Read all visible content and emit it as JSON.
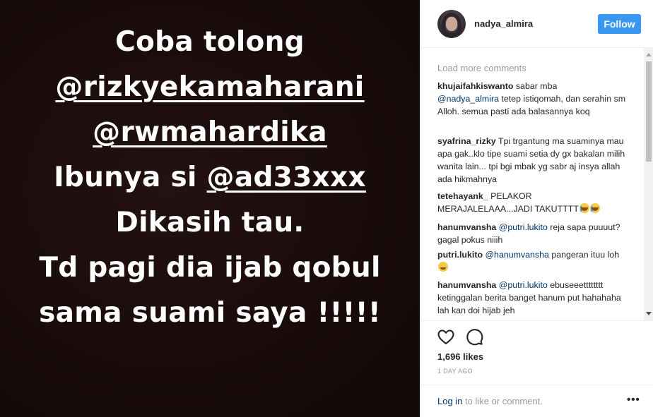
{
  "story": {
    "lines": [
      {
        "text": "Coba tolong",
        "underline": false
      },
      {
        "text": "@rizkyekamaharani",
        "underline": true
      },
      {
        "text": "@rwmahardika",
        "underline": true
      }
    ],
    "line4_prefix": "Ibunya si ",
    "line4_mention": "@ad33xxx",
    "line5": "Dikasih tau.",
    "line6": "Td pagi dia ijab qobul",
    "line7": "sama suami saya !!!!!"
  },
  "header": {
    "username": "nadya_almira",
    "follow_label": "Follow"
  },
  "comments": {
    "load_more": "Load more comments",
    "items": [
      {
        "user": "khujaifahkiswanto",
        "pre": " sabar mba ",
        "mention": "@nadya_almira",
        "post": " tetep istiqomah, dan serahin sm Alloh. semua pasti ada balasannya koq"
      },
      {
        "user": "syafrina_rizky",
        "pre": " Tpi trgantung ma suaminya mau apa gak..klo tipe suami setia dy gx bakalan milih wanita lain... tpi bgi mbak yg sabr aj insya allah ada hikmahnya",
        "mention": "",
        "post": ""
      },
      {
        "user": "tetehayank_",
        "pre": "  PELAKOR MERAJALELAAA...JADI TAKUTTTT",
        "mention": "",
        "post": ""
      },
      {
        "user": "hanumvansha",
        "pre": " ",
        "mention": "@putri.lukito",
        "post": " reja sapa puuuut? gagal pokus niiih"
      },
      {
        "user": "putri.lukito",
        "pre": " ",
        "mention": "@hanumvansha",
        "post": " pangeran ituu loh "
      },
      {
        "user": "hanumvansha",
        "pre": " ",
        "mention": "@putri.lukito",
        "post": " ebuseeetttttttt ketinggalan berita banget hanum put hahahaha lah kan doi hijab jeh"
      }
    ]
  },
  "icons": {
    "like": "heart-icon",
    "comment": "comment-icon",
    "more": "more-options-icon"
  },
  "stats": {
    "likes": "1,696 likes",
    "time": "1 DAY AGO"
  },
  "footer": {
    "login_link": "Log in",
    "login_rest": " to like or comment.",
    "more": "•••"
  },
  "colors": {
    "accent": "#3897f0",
    "link": "#003569",
    "story_bg": "#1c0e0e"
  }
}
